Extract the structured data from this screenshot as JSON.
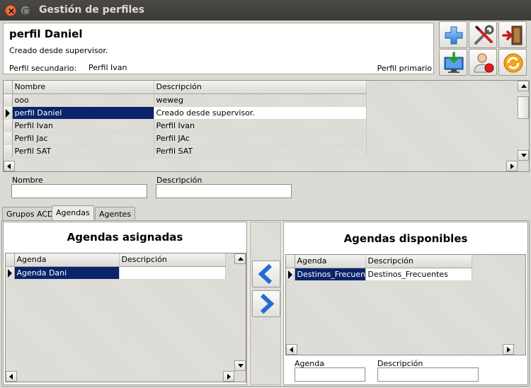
{
  "window": {
    "title": "Gestión de perfiles"
  },
  "header": {
    "profile_name": "perfil Daniel",
    "profile_description": "Creado desde supervisor.",
    "secondary_label": "Perfil secundario:",
    "secondary_value": "Perfil Ivan",
    "primary_label": "Perfil primario"
  },
  "toolbar": {
    "icons": [
      "add-icon",
      "tools-icon",
      "exit-door-icon",
      "download-monitor-icon",
      "user-remove-icon",
      "refresh-icon"
    ]
  },
  "profiles_grid": {
    "columns": [
      "Nombre",
      "Descripción"
    ],
    "rows": [
      {
        "name": "ooo",
        "description": "weweg"
      },
      {
        "name": "perfil Daniel",
        "description": "Creado desde supervisor."
      },
      {
        "name": "Perfil Ivan",
        "description": "Perfil Ivan"
      },
      {
        "name": "Perfil Jac",
        "description": "Perfil JAc"
      },
      {
        "name": "Perfil SAT",
        "description": "Perfil SAT"
      }
    ],
    "selected_index": 1
  },
  "filters": {
    "name_label": "Nombre",
    "name_value": "",
    "description_label": "Descripción",
    "description_value": ""
  },
  "tabs": [
    {
      "label": "Grupos ACD",
      "active": false
    },
    {
      "label": "Agendas",
      "active": true
    },
    {
      "label": "Agentes",
      "active": false
    }
  ],
  "assigned": {
    "title": "Agendas asignadas",
    "columns": [
      "Agenda",
      "Descripción"
    ],
    "rows": [
      {
        "agenda": "Agenda Dani",
        "description": ""
      }
    ]
  },
  "available": {
    "title": "Agendas disponibles",
    "columns": [
      "Agenda",
      "Descripción"
    ],
    "rows": [
      {
        "agenda": "Destinos_Frecuen",
        "description": "Destinos_Frecuentes"
      }
    ],
    "filter_agenda_label": "Agenda",
    "filter_agenda_value": "",
    "filter_description_label": "Descripción",
    "filter_description_value": ""
  },
  "colors": {
    "selection": "#0a246a",
    "titlebar": "#3c3b37",
    "close_button": "#e0531f"
  }
}
